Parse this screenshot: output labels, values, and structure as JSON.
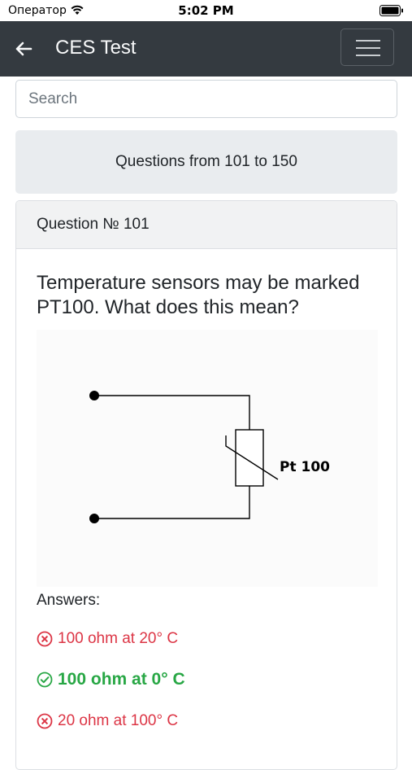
{
  "status_bar": {
    "carrier": "Оператор",
    "time": "5:02 PM"
  },
  "navbar": {
    "title": "CES Test",
    "bg_color": "#343a40"
  },
  "search": {
    "placeholder": "Search"
  },
  "range": {
    "label": "Questions from 101 to 150"
  },
  "question": {
    "header": "Question № 101",
    "text": "Temperature sensors may be marked PT100. What does this mean?",
    "diagram_label": "Pt 100",
    "answers_label": "Answers:",
    "answers": [
      {
        "text": "100 ohm at 20° C",
        "correct": false
      },
      {
        "text": "100 ohm at 0° C",
        "correct": true
      },
      {
        "text": "20 ohm at 100° C",
        "correct": false
      }
    ]
  },
  "colors": {
    "wrong": "#dc3545",
    "correct": "#28a745"
  }
}
